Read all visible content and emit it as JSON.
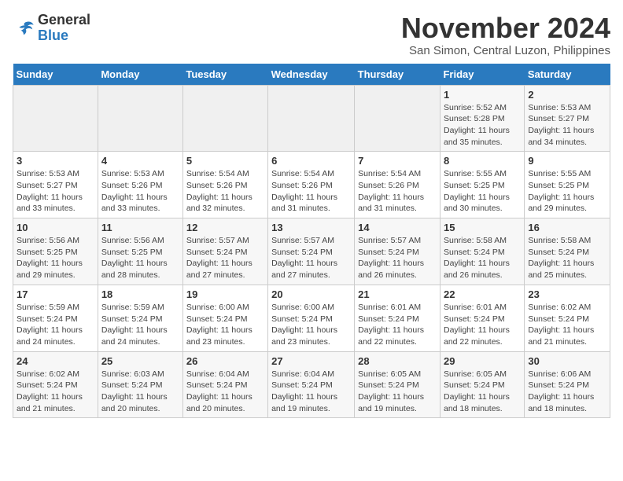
{
  "header": {
    "logo_general": "General",
    "logo_blue": "Blue",
    "month": "November 2024",
    "location": "San Simon, Central Luzon, Philippines"
  },
  "weekdays": [
    "Sunday",
    "Monday",
    "Tuesday",
    "Wednesday",
    "Thursday",
    "Friday",
    "Saturday"
  ],
  "weeks": [
    [
      {
        "day": "",
        "info": ""
      },
      {
        "day": "",
        "info": ""
      },
      {
        "day": "",
        "info": ""
      },
      {
        "day": "",
        "info": ""
      },
      {
        "day": "",
        "info": ""
      },
      {
        "day": "1",
        "info": "Sunrise: 5:52 AM\nSunset: 5:28 PM\nDaylight: 11 hours\nand 35 minutes."
      },
      {
        "day": "2",
        "info": "Sunrise: 5:53 AM\nSunset: 5:27 PM\nDaylight: 11 hours\nand 34 minutes."
      }
    ],
    [
      {
        "day": "3",
        "info": "Sunrise: 5:53 AM\nSunset: 5:27 PM\nDaylight: 11 hours\nand 33 minutes."
      },
      {
        "day": "4",
        "info": "Sunrise: 5:53 AM\nSunset: 5:26 PM\nDaylight: 11 hours\nand 33 minutes."
      },
      {
        "day": "5",
        "info": "Sunrise: 5:54 AM\nSunset: 5:26 PM\nDaylight: 11 hours\nand 32 minutes."
      },
      {
        "day": "6",
        "info": "Sunrise: 5:54 AM\nSunset: 5:26 PM\nDaylight: 11 hours\nand 31 minutes."
      },
      {
        "day": "7",
        "info": "Sunrise: 5:54 AM\nSunset: 5:26 PM\nDaylight: 11 hours\nand 31 minutes."
      },
      {
        "day": "8",
        "info": "Sunrise: 5:55 AM\nSunset: 5:25 PM\nDaylight: 11 hours\nand 30 minutes."
      },
      {
        "day": "9",
        "info": "Sunrise: 5:55 AM\nSunset: 5:25 PM\nDaylight: 11 hours\nand 29 minutes."
      }
    ],
    [
      {
        "day": "10",
        "info": "Sunrise: 5:56 AM\nSunset: 5:25 PM\nDaylight: 11 hours\nand 29 minutes."
      },
      {
        "day": "11",
        "info": "Sunrise: 5:56 AM\nSunset: 5:25 PM\nDaylight: 11 hours\nand 28 minutes."
      },
      {
        "day": "12",
        "info": "Sunrise: 5:57 AM\nSunset: 5:24 PM\nDaylight: 11 hours\nand 27 minutes."
      },
      {
        "day": "13",
        "info": "Sunrise: 5:57 AM\nSunset: 5:24 PM\nDaylight: 11 hours\nand 27 minutes."
      },
      {
        "day": "14",
        "info": "Sunrise: 5:57 AM\nSunset: 5:24 PM\nDaylight: 11 hours\nand 26 minutes."
      },
      {
        "day": "15",
        "info": "Sunrise: 5:58 AM\nSunset: 5:24 PM\nDaylight: 11 hours\nand 26 minutes."
      },
      {
        "day": "16",
        "info": "Sunrise: 5:58 AM\nSunset: 5:24 PM\nDaylight: 11 hours\nand 25 minutes."
      }
    ],
    [
      {
        "day": "17",
        "info": "Sunrise: 5:59 AM\nSunset: 5:24 PM\nDaylight: 11 hours\nand 24 minutes."
      },
      {
        "day": "18",
        "info": "Sunrise: 5:59 AM\nSunset: 5:24 PM\nDaylight: 11 hours\nand 24 minutes."
      },
      {
        "day": "19",
        "info": "Sunrise: 6:00 AM\nSunset: 5:24 PM\nDaylight: 11 hours\nand 23 minutes."
      },
      {
        "day": "20",
        "info": "Sunrise: 6:00 AM\nSunset: 5:24 PM\nDaylight: 11 hours\nand 23 minutes."
      },
      {
        "day": "21",
        "info": "Sunrise: 6:01 AM\nSunset: 5:24 PM\nDaylight: 11 hours\nand 22 minutes."
      },
      {
        "day": "22",
        "info": "Sunrise: 6:01 AM\nSunset: 5:24 PM\nDaylight: 11 hours\nand 22 minutes."
      },
      {
        "day": "23",
        "info": "Sunrise: 6:02 AM\nSunset: 5:24 PM\nDaylight: 11 hours\nand 21 minutes."
      }
    ],
    [
      {
        "day": "24",
        "info": "Sunrise: 6:02 AM\nSunset: 5:24 PM\nDaylight: 11 hours\nand 21 minutes."
      },
      {
        "day": "25",
        "info": "Sunrise: 6:03 AM\nSunset: 5:24 PM\nDaylight: 11 hours\nand 20 minutes."
      },
      {
        "day": "26",
        "info": "Sunrise: 6:04 AM\nSunset: 5:24 PM\nDaylight: 11 hours\nand 20 minutes."
      },
      {
        "day": "27",
        "info": "Sunrise: 6:04 AM\nSunset: 5:24 PM\nDaylight: 11 hours\nand 19 minutes."
      },
      {
        "day": "28",
        "info": "Sunrise: 6:05 AM\nSunset: 5:24 PM\nDaylight: 11 hours\nand 19 minutes."
      },
      {
        "day": "29",
        "info": "Sunrise: 6:05 AM\nSunset: 5:24 PM\nDaylight: 11 hours\nand 18 minutes."
      },
      {
        "day": "30",
        "info": "Sunrise: 6:06 AM\nSunset: 5:24 PM\nDaylight: 11 hours\nand 18 minutes."
      }
    ]
  ]
}
